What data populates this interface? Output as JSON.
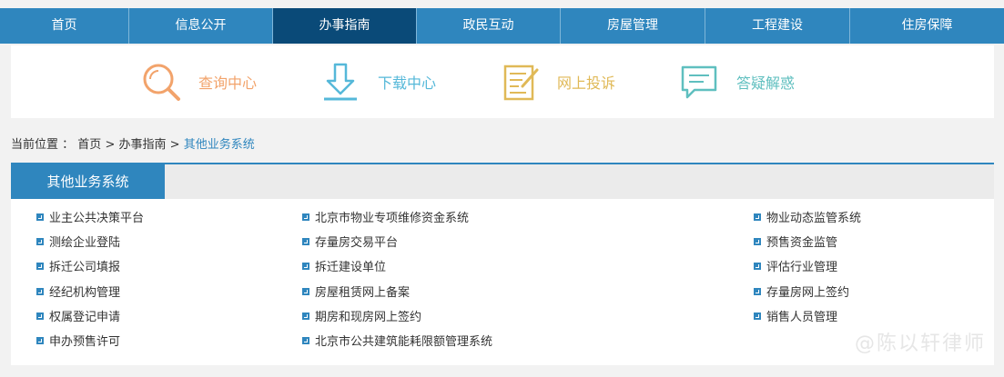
{
  "nav": [
    "首页",
    "信息公开",
    "办事指南",
    "政民互动",
    "房屋管理",
    "工程建设",
    "住房保障"
  ],
  "nav_active_index": 2,
  "quick_links": [
    {
      "label": "查询中心",
      "icon": "magnifier-icon",
      "color": "#f2a36b"
    },
    {
      "label": "下载中心",
      "icon": "download-icon",
      "color": "#55b8d9"
    },
    {
      "label": "网上投诉",
      "icon": "document-edit-icon",
      "color": "#e0b957"
    },
    {
      "label": "答疑解惑",
      "icon": "chat-bubble-icon",
      "color": "#5fbfbf"
    }
  ],
  "breadcrumb": {
    "prefix": "当前位置 ：",
    "items": [
      "首页",
      "办事指南"
    ],
    "sep": ">",
    "current": "其他业务系统"
  },
  "panel": {
    "title": "其他业务系统",
    "col1": [
      "业主公共决策平台",
      "测绘企业登陆",
      "拆迁公司填报",
      "经纪机构管理",
      "权属登记申请",
      "申办预售许可"
    ],
    "col2": [
      "北京市物业专项维修资金系统",
      "存量房交易平台",
      "拆迁建设单位",
      "房屋租赁网上备案",
      "期房和现房网上签约",
      "北京市公共建筑能耗限额管理系统"
    ],
    "col3": [
      "物业动态监管系统",
      "预售资金监管",
      "评估行业管理",
      "存量房网上签约",
      "销售人员管理"
    ]
  },
  "watermark": "@陈以轩律师",
  "colors": {
    "primary": "#2f86be",
    "active": "#0a4a78"
  }
}
